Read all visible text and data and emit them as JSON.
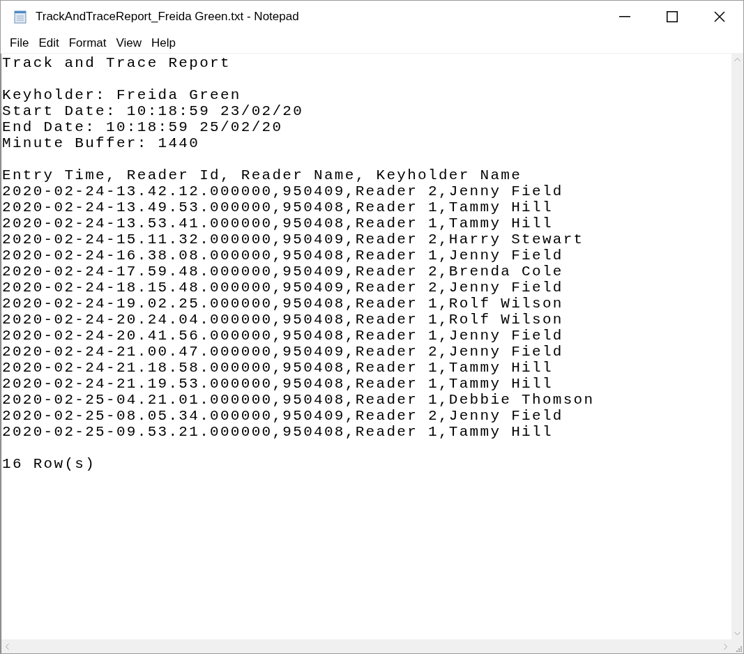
{
  "window": {
    "title": "TrackAndTraceReport_Freida Green.txt - Notepad"
  },
  "menu": [
    "File",
    "Edit",
    "Format",
    "View",
    "Help"
  ],
  "document": {
    "blocks": [
      [
        "Track and Trace Report"
      ],
      [
        "Keyholder: Freida Green",
        "Start Date: 10:18:59 23/02/20",
        "End Date: 10:18:59 25/02/20",
        "Minute Buffer: 1440"
      ],
      [
        "Entry Time, Reader Id, Reader Name, Keyholder Name",
        "2020-02-24-13.42.12.000000,950409,Reader 2,Jenny Field",
        "2020-02-24-13.49.53.000000,950408,Reader 1,Tammy Hill",
        "2020-02-24-13.53.41.000000,950408,Reader 1,Tammy Hill",
        "2020-02-24-15.11.32.000000,950409,Reader 2,Harry Stewart",
        "2020-02-24-16.38.08.000000,950408,Reader 1,Jenny Field",
        "2020-02-24-17.59.48.000000,950409,Reader 2,Brenda Cole",
        "2020-02-24-18.15.48.000000,950409,Reader 2,Jenny Field",
        "2020-02-24-19.02.25.000000,950408,Reader 1,Rolf Wilson",
        "2020-02-24-20.24.04.000000,950408,Reader 1,Rolf Wilson",
        "2020-02-24-20.41.56.000000,950408,Reader 1,Jenny Field",
        "2020-02-24-21.00.47.000000,950409,Reader 2,Jenny Field",
        "2020-02-24-21.18.58.000000,950408,Reader 1,Tammy Hill",
        "2020-02-24-21.19.53.000000,950408,Reader 1,Tammy Hill",
        "2020-02-25-04.21.01.000000,950408,Reader 1,Debbie Thomson",
        "2020-02-25-08.05.34.000000,950409,Reader 2,Jenny Field",
        "2020-02-25-09.53.21.000000,950408,Reader 1,Tammy Hill"
      ],
      [
        "16 Row(s)"
      ]
    ]
  }
}
